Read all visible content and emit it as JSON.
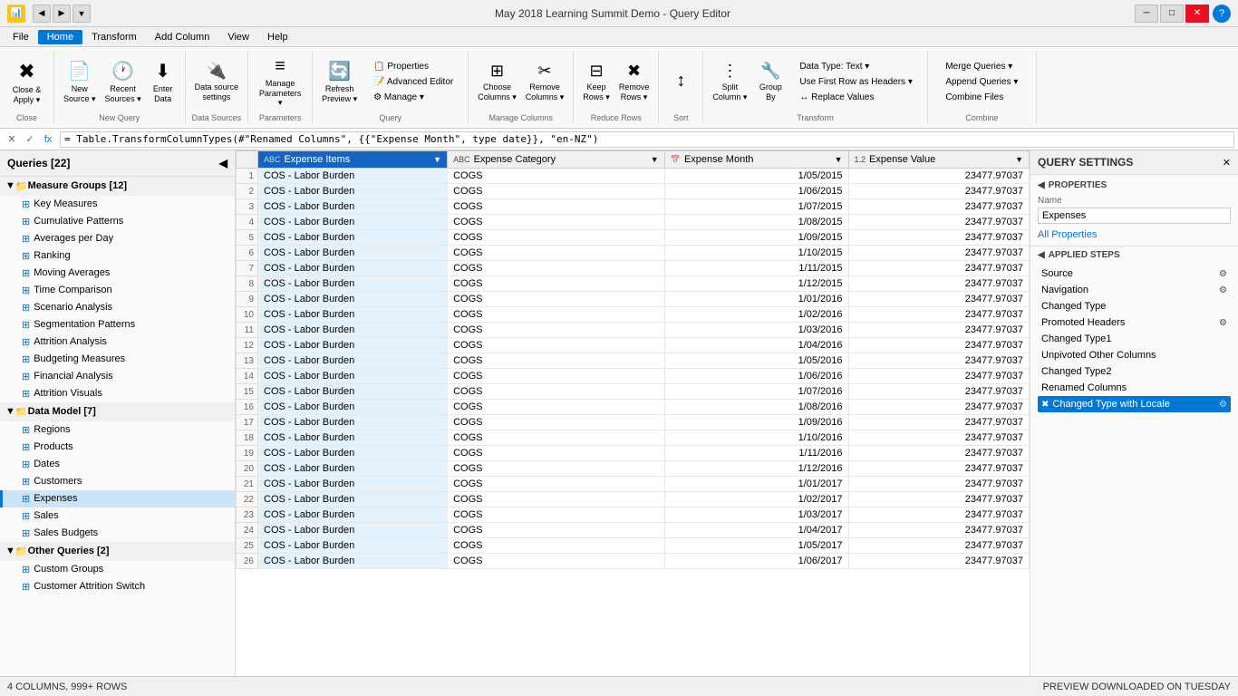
{
  "titleBar": {
    "icon": "📊",
    "controls": [
      "◀",
      "▶",
      "▼"
    ],
    "title": "May 2018 Learning Summit Demo - Query Editor",
    "winControls": [
      "─",
      "□",
      "✕"
    ]
  },
  "menuBar": {
    "items": [
      "File",
      "Home",
      "Transform",
      "Add Column",
      "View",
      "Help"
    ],
    "activeItem": "Home"
  },
  "ribbon": {
    "groups": [
      {
        "label": "Close",
        "items": [
          {
            "icon": "✖",
            "label": "Close &\nApply ▾",
            "name": "close-apply-btn"
          }
        ]
      },
      {
        "label": "New Query",
        "items": [
          {
            "icon": "📄",
            "label": "New\nSource ▾",
            "name": "new-source-btn"
          },
          {
            "icon": "🕐",
            "label": "Recent\nSources ▾",
            "name": "recent-sources-btn"
          },
          {
            "icon": "⬇",
            "label": "Enter\nData",
            "name": "enter-data-btn"
          }
        ]
      },
      {
        "label": "Data Sources",
        "items": [
          {
            "icon": "🔌",
            "label": "Data source\nsettings",
            "name": "data-source-settings-btn"
          }
        ]
      },
      {
        "label": "Parameters",
        "items": [
          {
            "icon": "≡",
            "label": "Manage\nParameters ▾",
            "name": "manage-params-btn"
          }
        ]
      },
      {
        "label": "Query",
        "items": [
          {
            "icon": "🔄",
            "label": "Refresh\nPreview ▾",
            "name": "refresh-preview-btn"
          },
          {
            "label": "Properties",
            "small": true,
            "name": "properties-btn"
          },
          {
            "label": "Advanced Editor",
            "small": true,
            "name": "advanced-editor-btn"
          },
          {
            "label": "Manage ▾",
            "small": true,
            "name": "manage-btn"
          }
        ]
      },
      {
        "label": "Manage Columns",
        "items": [
          {
            "icon": "⊞",
            "label": "Choose\nColumns ▾",
            "name": "choose-columns-btn"
          },
          {
            "icon": "✂",
            "label": "Remove\nColumns ▾",
            "name": "remove-columns-btn"
          }
        ]
      },
      {
        "label": "Reduce Rows",
        "items": [
          {
            "icon": "⊟",
            "label": "Keep\nRows ▾",
            "name": "keep-rows-btn"
          },
          {
            "icon": "✖",
            "label": "Remove\nRows ▾",
            "name": "remove-rows-btn"
          }
        ]
      },
      {
        "label": "Sort",
        "items": [
          {
            "icon": "↕",
            "label": "",
            "name": "sort-btn"
          }
        ]
      },
      {
        "label": "Transform",
        "items": [
          {
            "icon": "⋮",
            "label": "Split\nColumn ▾",
            "name": "split-column-btn"
          },
          {
            "icon": "🔧",
            "label": "Group\nBy",
            "name": "group-by-btn"
          },
          {
            "label": "Data Type: Text ▾",
            "small": true,
            "name": "data-type-btn"
          },
          {
            "label": "Use First Row as Headers ▾",
            "small": true,
            "name": "use-first-row-btn"
          },
          {
            "label": "↔ Replace Values",
            "small": true,
            "name": "replace-values-btn"
          }
        ]
      },
      {
        "label": "Combine",
        "items": [
          {
            "label": "Merge Queries ▾",
            "small": true,
            "name": "merge-queries-btn"
          },
          {
            "label": "Append Queries ▾",
            "small": true,
            "name": "append-queries-btn"
          },
          {
            "label": "Combine Files",
            "small": true,
            "name": "combine-files-btn"
          }
        ]
      }
    ]
  },
  "formulaBar": {
    "buttons": [
      "✕",
      "✓",
      "fx"
    ],
    "formula": "= Table.TransformColumnTypes(#\"Renamed Columns\", {{\"Expense Month\", type date}}, \"en-NZ\")"
  },
  "sidebar": {
    "title": "Queries [22]",
    "groups": [
      {
        "name": "Measure Groups [12]",
        "expanded": true,
        "items": [
          "Key Measures",
          "Cumulative Patterns",
          "Averages per Day",
          "Ranking",
          "Moving Averages",
          "Time Comparison",
          "Scenario Analysis",
          "Segmentation Patterns",
          "Attrition Analysis",
          "Budgeting Measures",
          "Financial Analysis",
          "Attrition Visuals"
        ]
      },
      {
        "name": "Data Model [7]",
        "expanded": true,
        "items": [
          "Regions",
          "Products",
          "Dates",
          "Customers",
          "Expenses",
          "Sales",
          "Sales Budgets"
        ],
        "activeItem": "Expenses"
      },
      {
        "name": "Other Queries [2]",
        "expanded": true,
        "items": [
          "Custom Groups",
          "Customer Attrition Switch"
        ]
      }
    ]
  },
  "table": {
    "columns": [
      {
        "name": "Expense Items",
        "type": "ABC",
        "selected": true
      },
      {
        "name": "Expense Category",
        "type": "ABC",
        "selected": false
      },
      {
        "name": "Expense Month",
        "type": "📅",
        "selected": false
      },
      {
        "name": "Expense Value",
        "type": "1.2",
        "selected": false
      }
    ],
    "rows": [
      {
        "num": 1,
        "col1": "COS - Labor Burden",
        "col2": "COGS",
        "col3": "1/05/2015",
        "col4": "23477.97037"
      },
      {
        "num": 2,
        "col1": "COS - Labor Burden",
        "col2": "COGS",
        "col3": "1/06/2015",
        "col4": "23477.97037"
      },
      {
        "num": 3,
        "col1": "COS - Labor Burden",
        "col2": "COGS",
        "col3": "1/07/2015",
        "col4": "23477.97037"
      },
      {
        "num": 4,
        "col1": "COS - Labor Burden",
        "col2": "COGS",
        "col3": "1/08/2015",
        "col4": "23477.97037"
      },
      {
        "num": 5,
        "col1": "COS - Labor Burden",
        "col2": "COGS",
        "col3": "1/09/2015",
        "col4": "23477.97037"
      },
      {
        "num": 6,
        "col1": "COS - Labor Burden",
        "col2": "COGS",
        "col3": "1/10/2015",
        "col4": "23477.97037"
      },
      {
        "num": 7,
        "col1": "COS - Labor Burden",
        "col2": "COGS",
        "col3": "1/11/2015",
        "col4": "23477.97037"
      },
      {
        "num": 8,
        "col1": "COS - Labor Burden",
        "col2": "COGS",
        "col3": "1/12/2015",
        "col4": "23477.97037"
      },
      {
        "num": 9,
        "col1": "COS - Labor Burden",
        "col2": "COGS",
        "col3": "1/01/2016",
        "col4": "23477.97037"
      },
      {
        "num": 10,
        "col1": "COS - Labor Burden",
        "col2": "COGS",
        "col3": "1/02/2016",
        "col4": "23477.97037"
      },
      {
        "num": 11,
        "col1": "COS - Labor Burden",
        "col2": "COGS",
        "col3": "1/03/2016",
        "col4": "23477.97037"
      },
      {
        "num": 12,
        "col1": "COS - Labor Burden",
        "col2": "COGS",
        "col3": "1/04/2016",
        "col4": "23477.97037"
      },
      {
        "num": 13,
        "col1": "COS - Labor Burden",
        "col2": "COGS",
        "col3": "1/05/2016",
        "col4": "23477.97037"
      },
      {
        "num": 14,
        "col1": "COS - Labor Burden",
        "col2": "COGS",
        "col3": "1/06/2016",
        "col4": "23477.97037"
      },
      {
        "num": 15,
        "col1": "COS - Labor Burden",
        "col2": "COGS",
        "col3": "1/07/2016",
        "col4": "23477.97037"
      },
      {
        "num": 16,
        "col1": "COS - Labor Burden",
        "col2": "COGS",
        "col3": "1/08/2016",
        "col4": "23477.97037"
      },
      {
        "num": 17,
        "col1": "COS - Labor Burden",
        "col2": "COGS",
        "col3": "1/09/2016",
        "col4": "23477.97037"
      },
      {
        "num": 18,
        "col1": "COS - Labor Burden",
        "col2": "COGS",
        "col3": "1/10/2016",
        "col4": "23477.97037"
      },
      {
        "num": 19,
        "col1": "COS - Labor Burden",
        "col2": "COGS",
        "col3": "1/11/2016",
        "col4": "23477.97037"
      },
      {
        "num": 20,
        "col1": "COS - Labor Burden",
        "col2": "COGS",
        "col3": "1/12/2016",
        "col4": "23477.97037"
      },
      {
        "num": 21,
        "col1": "COS - Labor Burden",
        "col2": "COGS",
        "col3": "1/01/2017",
        "col4": "23477.97037"
      },
      {
        "num": 22,
        "col1": "COS - Labor Burden",
        "col2": "COGS",
        "col3": "1/02/2017",
        "col4": "23477.97037"
      },
      {
        "num": 23,
        "col1": "COS - Labor Burden",
        "col2": "COGS",
        "col3": "1/03/2017",
        "col4": "23477.97037"
      },
      {
        "num": 24,
        "col1": "COS - Labor Burden",
        "col2": "COGS",
        "col3": "1/04/2017",
        "col4": "23477.97037"
      },
      {
        "num": 25,
        "col1": "COS - Labor Burden",
        "col2": "COGS",
        "col3": "1/05/2017",
        "col4": "23477.97037"
      },
      {
        "num": 26,
        "col1": "COS - Labor Burden",
        "col2": "COGS",
        "col3": "1/06/2017",
        "col4": "23477.97037"
      }
    ]
  },
  "querySettings": {
    "title": "QUERY SETTINGS",
    "sections": {
      "properties": {
        "title": "PROPERTIES",
        "nameLabel": "Name",
        "nameValue": "Expenses",
        "allPropertiesLink": "All Properties"
      },
      "appliedSteps": {
        "title": "APPLIED STEPS",
        "steps": [
          {
            "name": "Source",
            "hasGear": true,
            "active": false
          },
          {
            "name": "Navigation",
            "hasGear": true,
            "active": false
          },
          {
            "name": "Changed Type",
            "hasGear": false,
            "active": false
          },
          {
            "name": "Promoted Headers",
            "hasGear": true,
            "active": false
          },
          {
            "name": "Changed Type1",
            "hasGear": false,
            "active": false
          },
          {
            "name": "Unpivoted Other Columns",
            "hasGear": false,
            "active": false
          },
          {
            "name": "Changed Type2",
            "hasGear": false,
            "active": false
          },
          {
            "name": "Renamed Columns",
            "hasGear": false,
            "active": false
          },
          {
            "name": "Changed Type with Locale",
            "hasGear": true,
            "active": true,
            "hasError": true
          }
        ]
      }
    }
  },
  "statusBar": {
    "left": "4 COLUMNS, 999+ ROWS",
    "right": "PREVIEW DOWNLOADED ON TUESDAY"
  }
}
